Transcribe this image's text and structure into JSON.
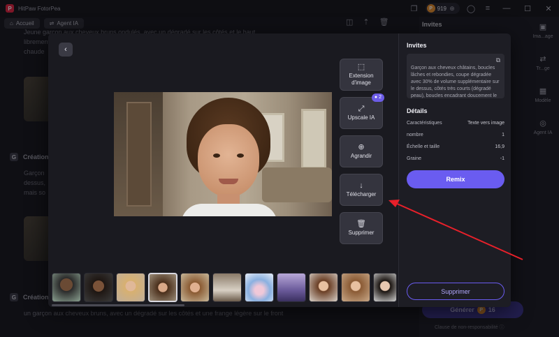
{
  "app": {
    "title": "HitPaw FotorPea",
    "coins": "919"
  },
  "background": {
    "tabs": [
      {
        "label": "Accueil"
      },
      {
        "label": "Agent IA"
      }
    ],
    "text_top_1": "Jeune garçon aux cheveux bruns ondulés, avec un dégradé sur les côtés et le haut",
    "text_top_2": "librement",
    "text_top_3": "chaude",
    "heading_1": "Création",
    "text_mid_1": "Garçon",
    "text_mid_2": "dessus,",
    "text_mid_3": "mais so",
    "heading_2": "Création",
    "bottom_prompt": "un garçon aux cheveux bruns, avec un dégradé sur les côtés et une frange légère sur le front",
    "right_panel_title": "Invites",
    "rail": [
      {
        "label": "Ima...age"
      },
      {
        "label": "Tr...ge"
      },
      {
        "label": "Modèle"
      },
      {
        "label": "Agent IA"
      }
    ],
    "generate_label": "Générer",
    "generate_cost": "16",
    "disclaimer": "Clause de non-responsabilité"
  },
  "modal": {
    "actions": [
      {
        "label": "Extension d'image",
        "icon": "image-extend-icon"
      },
      {
        "label": "Upscale IA",
        "icon": "upscale-icon",
        "badge": "2"
      },
      {
        "label": "Agrandir",
        "icon": "zoom-in-icon"
      },
      {
        "label": "Télécharger",
        "icon": "download-icon"
      },
      {
        "label": "Supprimer",
        "icon": "trash-icon"
      }
    ],
    "prompts_title": "Invites",
    "prompt_text": "Garçon aux cheveux châtains, boucles lâches et rebondies, coupe dégradée avec 30% de volume supplémentaire sur le dessus, côtés très courts (dégradé peau), boucles encadrant doucement le front",
    "details_title": "Détails",
    "details": [
      {
        "key": "Caractéristiques",
        "value": "Texte vers image"
      },
      {
        "key": "nombre",
        "value": "1"
      },
      {
        "key": "Échelle et taille",
        "value": "16,9"
      },
      {
        "key": "Graine",
        "value": "-1"
      }
    ],
    "remix_label": "Remix",
    "delete_label": "Supprimer",
    "thumbnails_selected_index": 3,
    "thumbnail_count": 11
  }
}
